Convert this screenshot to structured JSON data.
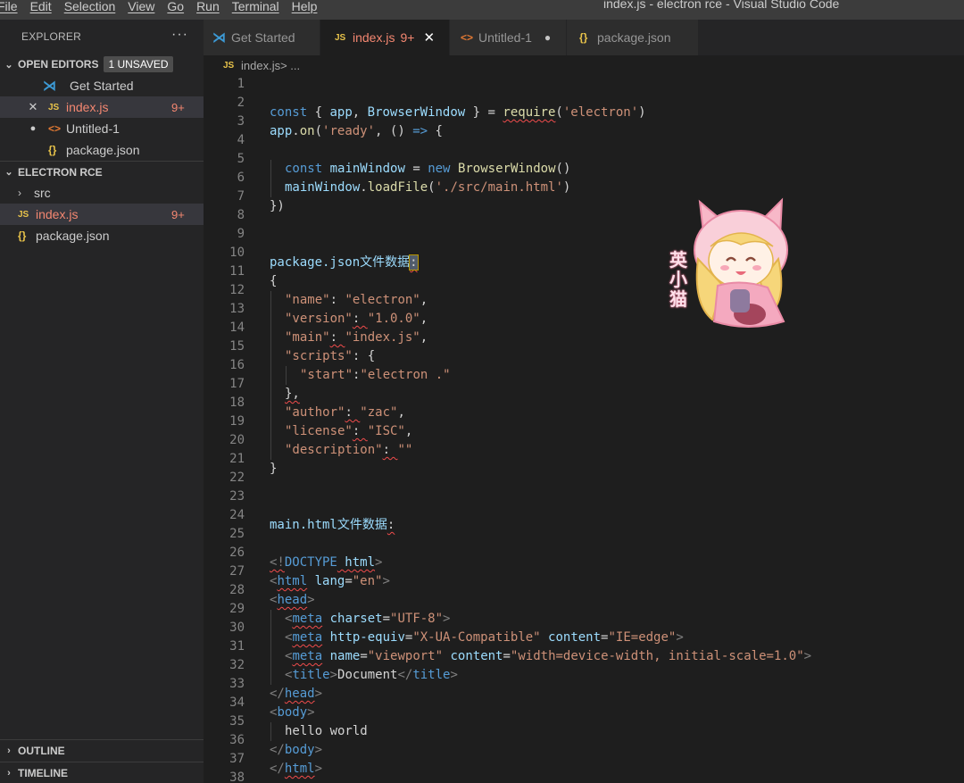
{
  "menu": [
    "File",
    "Edit",
    "Selection",
    "View",
    "Go",
    "Run",
    "Terminal",
    "Help"
  ],
  "window_title": "index.js - electron rce - Visual Studio Code",
  "sidebar": {
    "header": "EXPLORER",
    "more": "···",
    "open_editors": {
      "title": "OPEN EDITORS",
      "badge": "1 UNSAVED",
      "items": [
        {
          "label": "Get Started",
          "icon": "vscode-icon"
        },
        {
          "label": "index.js",
          "icon": "js-icon",
          "lead": "✕",
          "count": "9+"
        },
        {
          "label": "Untitled-1",
          "icon": "html-icon",
          "lead": "●"
        },
        {
          "label": "package.json",
          "icon": "json-icon"
        }
      ]
    },
    "project": {
      "title": "ELECTRON RCE",
      "items": [
        {
          "label": "src",
          "icon": "chevron-right-icon"
        },
        {
          "label": "index.js",
          "icon": "js-icon",
          "count": "9+"
        },
        {
          "label": "package.json",
          "icon": "json-icon"
        }
      ]
    },
    "outline": "OUTLINE",
    "timeline": "TIMELINE"
  },
  "tabs": [
    {
      "label": "Get Started"
    },
    {
      "label": "index.js",
      "count": "9+",
      "active": true
    },
    {
      "label": "Untitled-1"
    },
    {
      "label": "package.json"
    }
  ],
  "icons": {
    "js": "JS",
    "json": "{}",
    "html": "<>"
  },
  "breadcrumb": {
    "file": "index.js",
    "rest": " > ..."
  },
  "line_numbers": [
    "1",
    "2",
    "3",
    "4",
    "5",
    "6",
    "7",
    "8",
    "9",
    "10",
    "11",
    "12",
    "13",
    "14",
    "15",
    "16",
    "17",
    "18",
    "19",
    "20",
    "21",
    "22",
    "23",
    "24",
    "25",
    "26",
    "27",
    "28",
    "29",
    "30",
    "31",
    "32",
    "33",
    "34",
    "35",
    "36",
    "37",
    "38"
  ],
  "code": {
    "l2": [
      "const",
      "{",
      "app",
      ",",
      "BrowserWindow",
      "}",
      "=",
      "require",
      "(",
      "'electron'",
      ")"
    ],
    "l3": [
      "app",
      ".",
      "on",
      "(",
      "'ready'",
      ", () ",
      "=>",
      " {"
    ],
    "l5": [
      "const",
      "mainWindow",
      "=",
      "new",
      "BrowserWindow",
      "()"
    ],
    "l6": [
      "mainWindow",
      ".",
      "loadFile",
      "(",
      "'./src/main.html'",
      ")"
    ],
    "l7": "})",
    "l10": [
      "package.json文件数据",
      ":"
    ],
    "l11": "{",
    "l12": [
      "\"name\"",
      ": ",
      "\"electron\"",
      ","
    ],
    "l13": [
      "\"version\"",
      ": ",
      "\"1.0.0\"",
      ","
    ],
    "l14": [
      "\"main\"",
      ": ",
      "\"index.js\"",
      ","
    ],
    "l15": [
      "\"scripts\"",
      ": {"
    ],
    "l16": [
      "\"start\"",
      ":",
      "\"electron .\""
    ],
    "l17": "},",
    "l18": [
      "\"author\"",
      ": ",
      "\"zac\"",
      ","
    ],
    "l19": [
      "\"license\"",
      ": ",
      "\"ISC\"",
      ","
    ],
    "l20": [
      "\"description\"",
      ": ",
      "\"\""
    ],
    "l21": "}",
    "l24": [
      "main.html文件数据",
      ":"
    ],
    "l26": [
      "<!",
      "DOCTYPE",
      " html",
      ">"
    ],
    "l27": [
      "<",
      "html",
      " lang",
      "=",
      "\"en\"",
      ">"
    ],
    "l28": [
      "<",
      "head",
      ">"
    ],
    "l29": [
      "<",
      "meta",
      " charset",
      "=",
      "\"UTF-8\"",
      ">"
    ],
    "l30": [
      "<",
      "meta",
      " http-equiv",
      "=",
      "\"X-UA-Compatible\"",
      " content",
      "=",
      "\"IE=edge\"",
      ">"
    ],
    "l31": [
      "<",
      "meta",
      " name",
      "=",
      "\"viewport\"",
      " content",
      "=",
      "\"width=device-width, initial-scale=1.0\"",
      ">"
    ],
    "l32": [
      "<",
      "title",
      ">",
      "Document",
      "</",
      "title",
      ">"
    ],
    "l33": [
      "</",
      "head",
      ">"
    ],
    "l34": [
      "<",
      "body",
      ">"
    ],
    "l35": "hello world",
    "l36": [
      "</",
      "body",
      ">"
    ],
    "l37": [
      "</",
      "html",
      ">"
    ]
  },
  "sticker_text": "英小猫",
  "colors": {
    "accent_error": "#f48771",
    "keyword": "#569cd6",
    "string": "#ce9178",
    "variable": "#9cdcfe",
    "function": "#dcdcaa"
  }
}
